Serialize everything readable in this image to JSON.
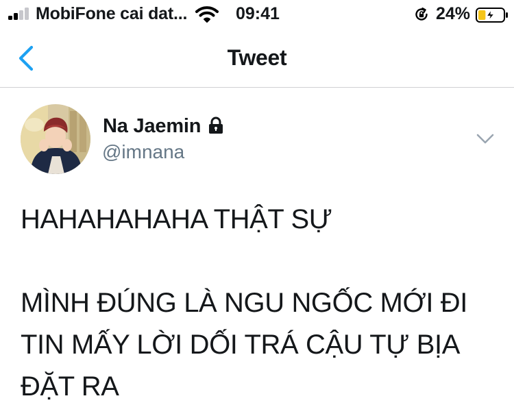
{
  "status_bar": {
    "carrier": "MobiFone cai dat...",
    "time": "09:41",
    "battery_percent": "24%",
    "battery_level": 0.24,
    "signal_bars_active": 2,
    "icons": [
      "cellular-signal-icon",
      "wifi-icon",
      "rotation-lock-icon",
      "battery-charging-icon"
    ]
  },
  "nav": {
    "title": "Tweet",
    "back_icon": "chevron-left-icon"
  },
  "tweet": {
    "author": {
      "display_name": "Na Jaemin",
      "handle": "@imnana",
      "protected_icon": "lock-icon"
    },
    "more_icon": "chevron-down-icon",
    "lines": [
      "HAHAHAHAHA THẬT SỰ",
      "",
      "MÌNH ĐÚNG LÀ NGU NGỐC MỚI ĐI",
      "TIN MẤY LỜI DỐI TRÁ CẬU TỰ BỊA",
      "ĐẶT RA"
    ]
  },
  "colors": {
    "accent": "#1da1f2",
    "text": "#14171a",
    "secondary_text": "#657786",
    "battery_fill": "#f5c518",
    "divider": "#d0d0d3"
  }
}
